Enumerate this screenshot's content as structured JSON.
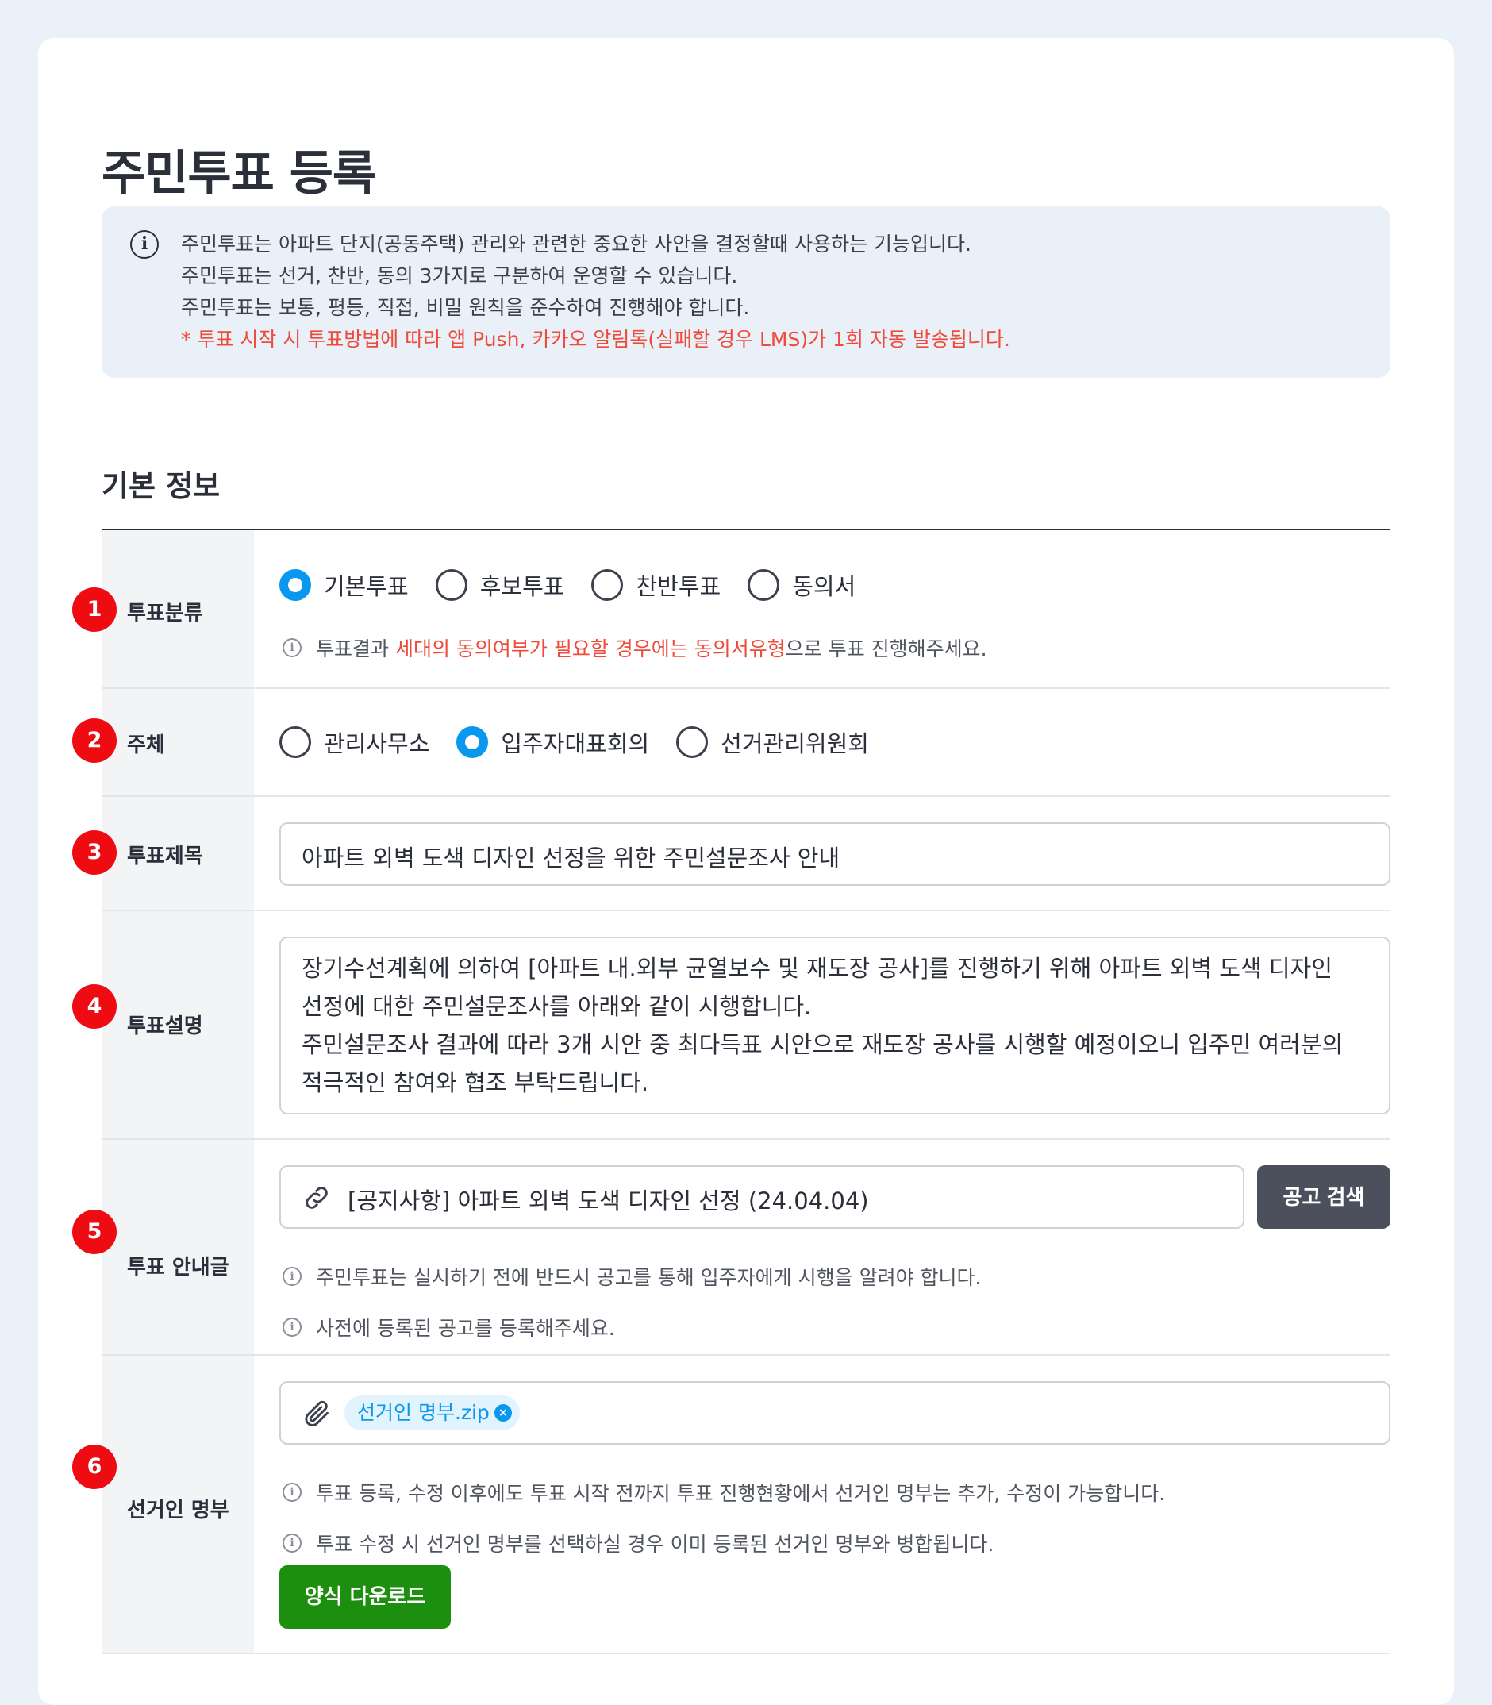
{
  "page": {
    "title": "주민투표 등록"
  },
  "notice": {
    "icon": "info-icon",
    "lines": [
      "주민투표는 아파트 단지(공동주택) 관리와 관련한 중요한 사안을 결정할때 사용하는 기능입니다.",
      "주민투표는 선거, 찬반, 동의 3가지로 구분하여 운영할 수 있습니다.",
      "주민투표는 보통, 평등, 직접, 비밀 원칙을 준수하여 진행해야 합니다.",
      "* 투표 시작 시 투표방법에 따라 앱 Push, 카카오 알림톡(실패할 경우 LMS)가 1회 자동 발송됩니다."
    ]
  },
  "section": {
    "title": "기본 정보"
  },
  "rows": {
    "category": {
      "badge": "1",
      "label": "투표분류",
      "options": [
        "기본투표",
        "후보투표",
        "찬반투표",
        "동의서"
      ],
      "selected": "기본투표",
      "hint": {
        "before": "투표결과 ",
        "highlight": "세대의 동의여부가 필요할 경우에는 동의서유형",
        "after": "으로 투표 진행해주세요."
      }
    },
    "subject": {
      "badge": "2",
      "label": "주체",
      "options": [
        "관리사무소",
        "입주자대표회의",
        "선거관리위원회"
      ],
      "selected": "입주자대표회의"
    },
    "title": {
      "badge": "3",
      "label": "투표제목",
      "value": "아파트 외벽 도색 디자인 선정을 위한 주민설문조사 안내"
    },
    "description": {
      "badge": "4",
      "label": "투표설명",
      "lines": [
        "장기수선계획에 의하여 [아파트 내.외부 균열보수 및 재도장 공사]를 진행하기 위해 아파트 외벽 도색 디자인",
        "선정에 대한 주민설문조사를 아래와 같이 시행합니다.",
        "주민설문조사 결과에 따라 3개 시안 중 최다득표 시안으로 재도장 공사를 시행할 예정이오니 입주민 여러분의",
        "적극적인 참여와 협조 부탁드립니다."
      ]
    },
    "notice_link": {
      "badge": "5",
      "label": "투표 안내글",
      "value": "[공지사항] 아파트 외벽 도색 디자인 선정 (24.04.04)",
      "link_icon": "link-icon",
      "button": "공고 검색",
      "hints": [
        "주민투표는 실시하기 전에 반드시 공고를 통해 입주자에게 시행을 알려야 합니다.",
        "사전에 등록된 공고를 등록해주세요."
      ]
    },
    "voter_list": {
      "badge": "6",
      "label": "선거인 명부",
      "attach_icon": "paperclip-icon",
      "file": "선거인 명부.zip",
      "hints": [
        "투표 등록, 수정 이후에도 투표 시작 전까지 투표 진행현황에서 선거인 명부는 추가, 수정이 가능합니다.",
        "투표 수정 시 선거인 명부를 선택하실 경우 이미 등록된 선거인 명부와 병합됩니다."
      ],
      "button": "양식 다운로드"
    }
  },
  "colors": {
    "accent": "#0a97ee",
    "badge": "#ee0b12",
    "warning_text": "#ee4b3a",
    "download_button": "#1d8f0f",
    "search_button": "#4b505c"
  }
}
